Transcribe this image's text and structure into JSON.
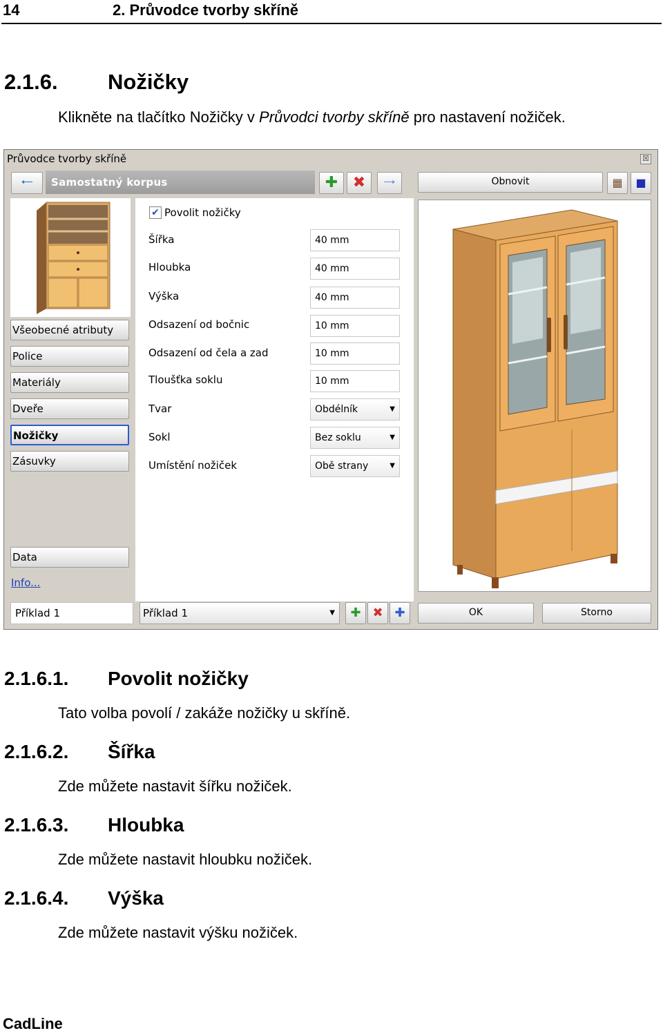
{
  "page": {
    "number": "14",
    "header": "2. Průvodce tvorby skříně",
    "footer": "CadLine"
  },
  "section": {
    "number": "2.1.6.",
    "title": "Nožičky",
    "intro_a": "Klikněte na tlačítko Nožičky v ",
    "intro_b": "Průvodci tvorby skříně",
    "intro_c": " pro nastavení nožiček."
  },
  "dialog": {
    "title": "Průvodce tvorby skříně",
    "close": "☒",
    "breadcrumb": "Samostatný korpus",
    "refresh_label": "Obnovit",
    "enable_label": "Povolit nožičky",
    "enable_checked": true,
    "fields": [
      {
        "label": "Šířka",
        "value": "40 mm"
      },
      {
        "label": "Hloubka",
        "value": "40 mm"
      },
      {
        "label": "Výška",
        "value": "40 mm"
      },
      {
        "label": "Odsazení od bočnic",
        "value": "10 mm"
      },
      {
        "label": "Odsazení od čela a zad",
        "value": "10 mm"
      },
      {
        "label": "Tloušťka soklu",
        "value": "10 mm"
      },
      {
        "label": "Tvar",
        "value": "Obdélník"
      },
      {
        "label": "Sokl",
        "value": "Bez soklu"
      },
      {
        "label": "Umístění nožiček",
        "value": "Obě strany"
      }
    ],
    "side_buttons": [
      "Všeobecné atributy",
      "Police",
      "Materiály",
      "Dveře",
      "Nožičky",
      "Zásuvky"
    ],
    "data_label": "Data",
    "info_label": "Info...",
    "name_value": "Příklad 1",
    "template_value": "Příklad 1",
    "ok_label": "OK",
    "cancel_label": "Storno"
  },
  "subsections": [
    {
      "number": "2.1.6.1.",
      "title": "Povolit nožičky",
      "text": "Tato volba povolí / zakáže nožičky u skříně."
    },
    {
      "number": "2.1.6.2.",
      "title": "Šířka",
      "text": "Zde můžete nastavit šířku nožiček."
    },
    {
      "number": "2.1.6.3.",
      "title": "Hloubka",
      "text": "Zde můžete nastavit hloubku nožiček."
    },
    {
      "number": "2.1.6.4.",
      "title": "Výška",
      "text": "Zde můžete nastavit výšku nožiček."
    }
  ]
}
